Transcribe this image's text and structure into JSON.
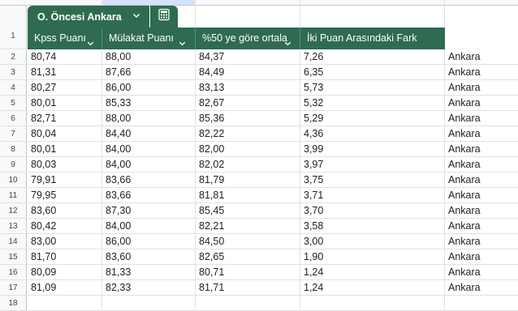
{
  "table_tab": {
    "name": "O. Öncesi Ankara"
  },
  "icons": {
    "tab_dropdown": "chevron-down-icon",
    "calculator": "calculator-icon",
    "column_dropdown": "chevron-down-icon"
  },
  "colors": {
    "table_header": "#2f6b50",
    "selected_column_header": "#d3e3fd"
  },
  "columns": [
    {
      "label": "Kpss Puanı"
    },
    {
      "label": "Mülakat Puanı"
    },
    {
      "label": "%50 ye göre ortala"
    },
    {
      "label": "İki Puan Arasındaki Fark"
    }
  ],
  "header_row_number": "1",
  "rows": [
    {
      "num": "2",
      "c": [
        "80,74",
        "88,00",
        "84,37",
        "7,26",
        "Ankara"
      ]
    },
    {
      "num": "3",
      "c": [
        "81,31",
        "87,66",
        "84,49",
        "6,35",
        "Ankara"
      ]
    },
    {
      "num": "4",
      "c": [
        "80,27",
        "86,00",
        "83,13",
        "5,73",
        "Ankara"
      ]
    },
    {
      "num": "5",
      "c": [
        "80,01",
        "85,33",
        "82,67",
        "5,32",
        "Ankara"
      ]
    },
    {
      "num": "6",
      "c": [
        "82,71",
        "88,00",
        "85,36",
        "5,29",
        "Ankara"
      ]
    },
    {
      "num": "7",
      "c": [
        "80,04",
        "84,40",
        "82,22",
        "4,36",
        "Ankara"
      ]
    },
    {
      "num": "8",
      "c": [
        "80,01",
        "84,00",
        "82,00",
        "3,99",
        "Ankara"
      ]
    },
    {
      "num": "9",
      "c": [
        "80,03",
        "84,00",
        "82,02",
        "3,97",
        "Ankara"
      ]
    },
    {
      "num": "10",
      "c": [
        "79,91",
        "83,66",
        "81,79",
        "3,75",
        "Ankara"
      ]
    },
    {
      "num": "11",
      "c": [
        "79,95",
        "83,66",
        "81,81",
        "3,71",
        "Ankara"
      ]
    },
    {
      "num": "12",
      "c": [
        "83,60",
        "87,30",
        "85,45",
        "3,70",
        "Ankara"
      ]
    },
    {
      "num": "13",
      "c": [
        "80,42",
        "84,00",
        "82,21",
        "3,58",
        "Ankara"
      ]
    },
    {
      "num": "14",
      "c": [
        "83,00",
        "86,00",
        "84,50",
        "3,00",
        "Ankara"
      ]
    },
    {
      "num": "15",
      "c": [
        "81,70",
        "83,60",
        "82,65",
        "1,90",
        "Ankara"
      ]
    },
    {
      "num": "16",
      "c": [
        "80,09",
        "81,33",
        "80,71",
        "1,24",
        "Ankara"
      ]
    },
    {
      "num": "17",
      "c": [
        "81,09",
        "82,33",
        "81,71",
        "1,24",
        "Ankara"
      ]
    },
    {
      "num": "18",
      "c": [
        "",
        "",
        "",
        "",
        ""
      ]
    }
  ]
}
